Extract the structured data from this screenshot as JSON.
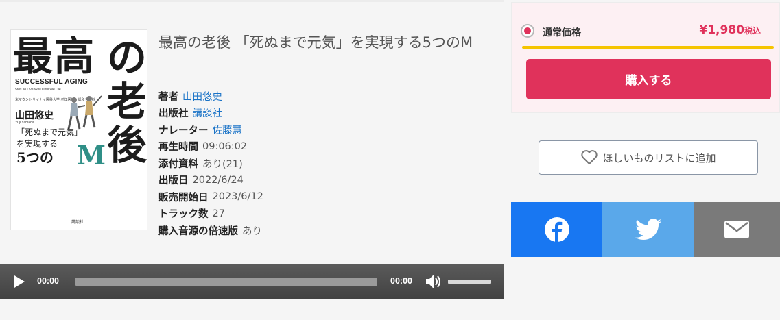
{
  "book": {
    "title": "最高の老後 「死ぬまで元気」を実現する5つのM",
    "cover": {
      "title_top": "最高",
      "title_right": "の老後",
      "english_title": "SUCCESSFUL AGING",
      "english_subtitle": "5Ms To Live Well Until We Die",
      "affiliation": "米マウントサイナイ医科大学 老年医学・緩和ケア科",
      "author": "山田悠史",
      "author_en": "Yuji Yamada",
      "subtitle_1": "「死ぬまで元気」",
      "subtitle_2": "を実現する",
      "subtitle_3": "5つの",
      "subtitle_m": "M",
      "publisher": "講談社",
      "accent_color": "#2f8f87"
    }
  },
  "meta": {
    "author_label": "著者",
    "author_value": "山田悠史",
    "publisher_label": "出版社",
    "publisher_value": "講談社",
    "narrator_label": "ナレーター",
    "narrator_value": "佐藤慧",
    "duration_label": "再生時間",
    "duration_value": "09:06:02",
    "attachments_label": "添付資料",
    "attachments_value": "あり(21)",
    "pubdate_label": "出版日",
    "pubdate_value": "2022/6/24",
    "saledate_label": "販売開始日",
    "saledate_value": "2023/6/12",
    "tracks_label": "トラック数",
    "tracks_value": "27",
    "speed_label": "購入音源の倍速版",
    "speed_value": "あり"
  },
  "player": {
    "current_time": "00:00",
    "duration": "00:00",
    "play_icon": "play-icon",
    "volume_icon": "volume-icon"
  },
  "purchase": {
    "price_label": "通常価格",
    "price": "¥1,980",
    "tax_label": "税込",
    "buy_label": "購入する",
    "wishlist_label": "ほしいものリストに追加",
    "brand_color": "#e0325b"
  },
  "share": {
    "facebook_icon": "facebook-icon",
    "twitter_icon": "twitter-icon",
    "mail_icon": "mail-icon"
  }
}
